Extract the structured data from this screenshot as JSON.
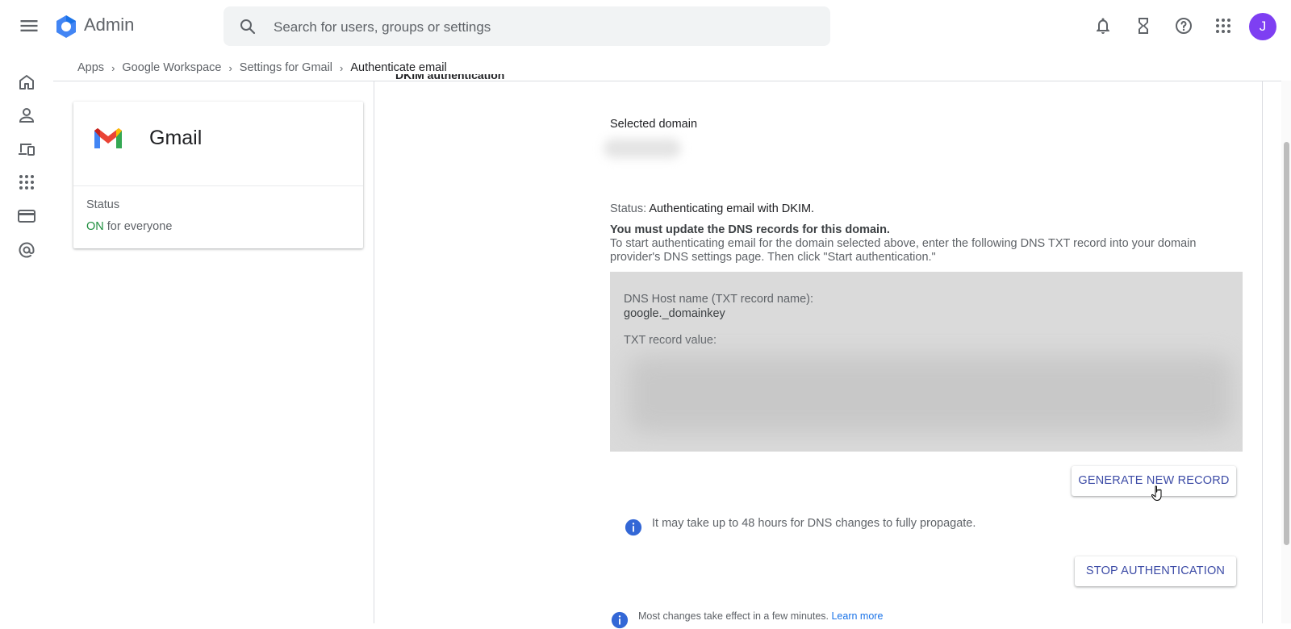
{
  "app": {
    "title": "Admin"
  },
  "search": {
    "placeholder": "Search for users, groups or settings"
  },
  "topbar": {
    "icons": [
      "bell-icon",
      "hourglass-icon",
      "help-icon",
      "apps-grid-icon"
    ],
    "avatar_initial": "J",
    "avatar_color": "#7e3ff2"
  },
  "rail": {
    "icons": [
      "home-icon",
      "user-icon",
      "devices-icon",
      "apps-icon",
      "billing-icon",
      "account-at-icon"
    ]
  },
  "breadcrumb": {
    "items": [
      "Apps",
      "Google Workspace",
      "Settings for Gmail"
    ],
    "current": "Authenticate email"
  },
  "app_card": {
    "title": "Gmail",
    "status_label": "Status",
    "status_value": "ON",
    "status_suffix": " for everyone"
  },
  "dkim": {
    "section_heading": "DKIM authentication",
    "selected_domain_label": "Selected domain",
    "status_label": "Status: ",
    "status_value": "Authenticating email with DKIM.",
    "must_update": "You must update the DNS records for this domain.",
    "instructions": "To start authenticating email for the domain selected above, enter the following DNS TXT record into your domain provider's DNS settings page. Then click \"Start authentication.\"",
    "dns_host_label": "DNS Host name (TXT record name):",
    "dns_host_value": "google._domainkey",
    "txt_value_label": "TXT record value:",
    "generate_button": "GENERATE NEW RECORD",
    "propagation_note": "It may take up to 48 hours for DNS changes to fully propagate.",
    "stop_button": "STOP AUTHENTICATION",
    "footer_note": "Most changes take effect in a few minutes. ",
    "learn_more": "Learn more"
  },
  "colors": {
    "accent": "#1a73e8",
    "button_text": "#3c4ba6",
    "status_on": "#1e8e3e",
    "info_icon": "#3367d6",
    "record_bg": "#dadada"
  }
}
